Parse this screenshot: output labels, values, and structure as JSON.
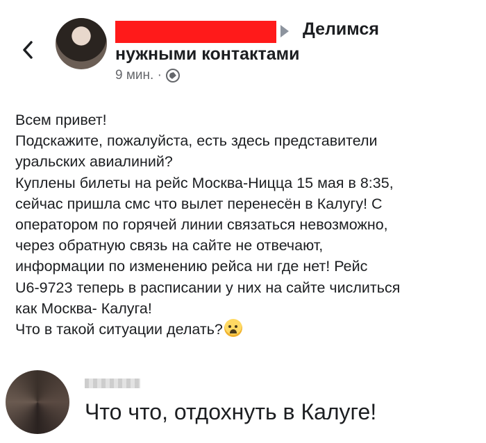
{
  "post": {
    "group_name_part1": "Делимся",
    "group_name_part2": "нужными контактами",
    "time": "9 мин. ·",
    "lines": [
      "Всем привет!",
      "Подскажите, пожалуйста, есть здесь представители",
      "уральских авиалиний?",
      "Куплены билеты на рейс Москва-Ницца 15 мая в 8:35,",
      "сейчас пришла смс что вылет перенесён в Калугу! С",
      "оператором по горячей линии связаться невозможно,",
      "через обратную связь на сайте не отвечают,",
      "информации по изменению рейса ни где нет! Рейс",
      "U6-9723 теперь в расписании у них на сайте числиться",
      "как Москва- Калуга!",
      "Что в такой ситуации делать?"
    ]
  },
  "comment": {
    "text": "Что что, отдохнуть в Калуге!"
  },
  "colors": {
    "redaction": "#ff1a1a",
    "text": "#1c1e21",
    "meta": "#65676b"
  },
  "icons": {
    "back": "chevron-left-icon",
    "privacy": "globe-icon",
    "emoji": "crying-face-icon"
  }
}
